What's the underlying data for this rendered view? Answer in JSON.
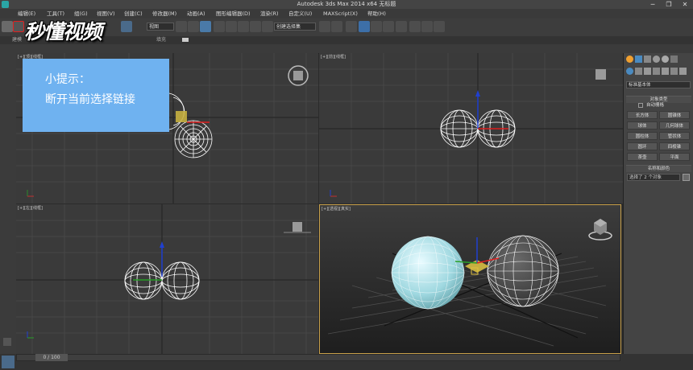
{
  "window": {
    "title": "Autodesk 3ds Max  2014 x64      无标题",
    "minimize": "─",
    "restore": "❐",
    "close": "✕"
  },
  "menu": [
    "编辑(E)",
    "工具(T)",
    "组(G)",
    "视图(V)",
    "创建(C)",
    "修改器(M)",
    "动画(A)",
    "图形编辑器(D)",
    "渲染(R)",
    "自定义(U)",
    "MAXScript(X)",
    "帮助(H)"
  ],
  "toolbar": {
    "view_dropdown": "视图",
    "selection_set_dropdown": "创建选择集"
  },
  "ribbon_tabs": [
    "建模",
    "填充"
  ],
  "logo": {
    "text": "秒懂视频"
  },
  "tip": {
    "title": "小提示：",
    "body": "断开当前选择链接"
  },
  "viewports": {
    "top": "[+][顶][线框]",
    "front": "[+][前][线框]",
    "left": "[+][左][线框]",
    "perspective": "[+][透视][真实]"
  },
  "command_panel": {
    "category_dropdown": "标准基本体",
    "section_object_type": "对象类型",
    "auto_grid": "自动栅格",
    "primitives": [
      "长方体",
      "圆锥体",
      "球体",
      "几何球体",
      "圆柱体",
      "管状体",
      "圆环",
      "四棱锥",
      "茶壶",
      "平面"
    ],
    "section_name_color": "名称和颜色",
    "name_field": "选择了 2 个对象"
  },
  "timeline": {
    "frame_counter": "0 / 100"
  },
  "colors": {
    "accent_active_viewport": "#c8a04a",
    "tip_box": "#6fb2f0",
    "selection_highlight": "#d22222"
  }
}
